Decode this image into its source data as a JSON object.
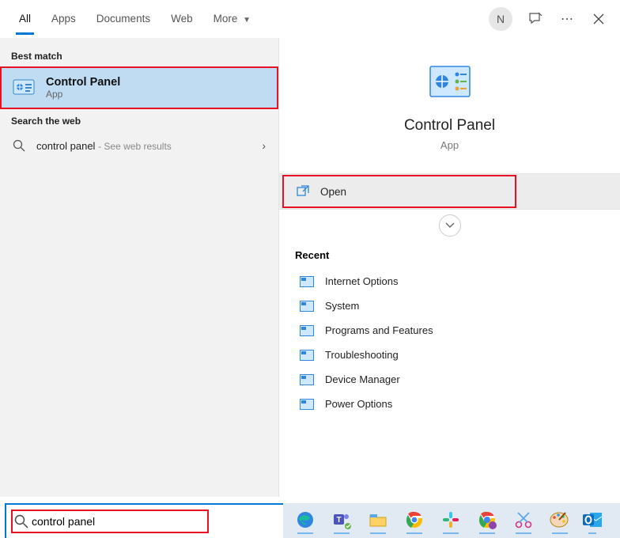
{
  "tabs": {
    "all": "All",
    "apps": "Apps",
    "documents": "Documents",
    "web": "Web",
    "more": "More"
  },
  "avatar": "N",
  "left": {
    "best_match_label": "Best match",
    "result_title": "Control Panel",
    "result_sub": "App",
    "search_web_label": "Search the web",
    "web_query": "control panel",
    "web_hint": "See web results"
  },
  "right": {
    "title": "Control Panel",
    "sub": "App",
    "open": "Open",
    "recent_label": "Recent",
    "recent": [
      "Internet Options",
      "System",
      "Programs and Features",
      "Troubleshooting",
      "Device Manager",
      "Power Options"
    ]
  },
  "search_value": "control panel"
}
